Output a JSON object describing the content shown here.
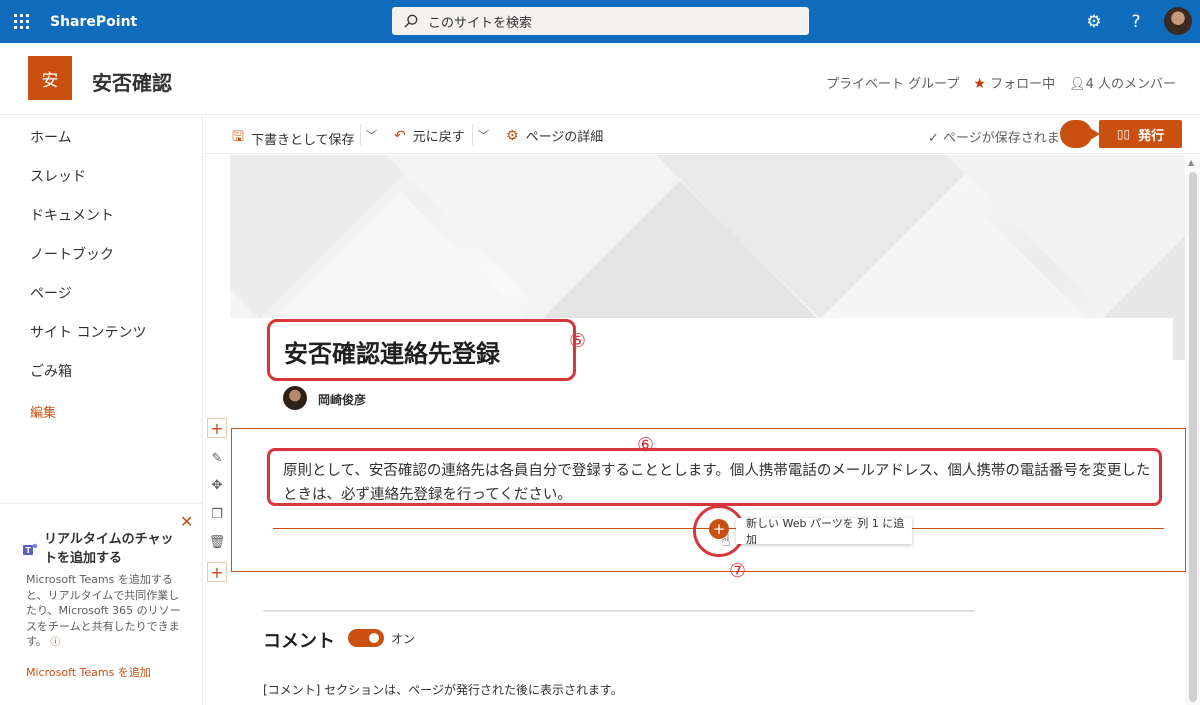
{
  "suite": {
    "app_name": "SharePoint",
    "search_placeholder": "このサイトを検索"
  },
  "site": {
    "logo_text": "安",
    "title": "安否確認",
    "privacy": "プライベート グループ",
    "follow": "フォロー中",
    "members": "4 人のメンバー"
  },
  "nav": {
    "items": [
      {
        "label": "ホーム"
      },
      {
        "label": "スレッド"
      },
      {
        "label": "ドキュメント"
      },
      {
        "label": "ノートブック"
      },
      {
        "label": "ページ"
      },
      {
        "label": "サイト コンテンツ"
      },
      {
        "label": "ごみ箱"
      }
    ],
    "edit_label": "編集"
  },
  "promo": {
    "title": "リアルタイムのチャットを追加する",
    "body": "Microsoft Teams を追加すると、リアルタイムで共同作業したり、Microsoft 365 のリソースをチームと共有したりできます。",
    "link": "Microsoft Teams を追加"
  },
  "command_bar": {
    "save_draft": "下書きとして保存",
    "undo": "元に戻す",
    "page_details": "ページの詳細",
    "saved_status": "ページが保存されま",
    "publish": "発行"
  },
  "page": {
    "title": "安否確認連絡先登録",
    "author": "岡崎俊彦",
    "body": "原則として、安否確認の連絡先は各員自分で登録することとします。個人携帯電話のメールアドレス、個人携帯の電話番号を変更したときは、必ず連絡先登録を行ってください。",
    "add_webpart_tooltip": "新しい Web パーツを 列 1 に追加",
    "markers": {
      "five": "⑤",
      "six": "⑥",
      "seven": "⑦"
    }
  },
  "comments": {
    "title": "コメント",
    "toggle_label": "オン",
    "note": "[コメント] セクションは、ページが発行された後に表示されます。"
  },
  "colors": {
    "suite_bar": "#0f6cbd",
    "accent": "#ca5010",
    "annotation": "#d8353b"
  }
}
